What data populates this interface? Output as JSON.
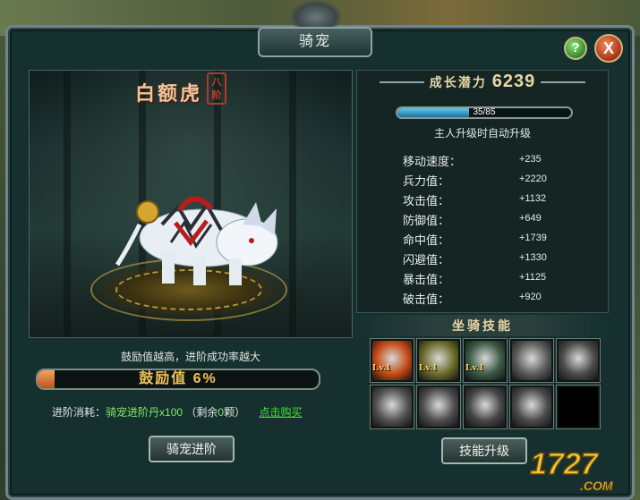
{
  "window": {
    "title": "骑宠"
  },
  "controls": {
    "help_label": "?",
    "close_label": "X"
  },
  "pet": {
    "name": "白额虎",
    "rank": [
      "八",
      "阶"
    ],
    "hint": "鼓励值越高，进阶成功率越大",
    "inspire_label": "鼓励值 6%",
    "inspire_fraction": 0.06
  },
  "advance": {
    "cost_label": "进阶消耗：",
    "cost_item": "骑宠进阶丹x100",
    "remaining_prefix": "（剩余",
    "remaining_count": "0",
    "remaining_suffix": "颗）",
    "buy_link": "点击购买",
    "button_label": "骑宠进阶"
  },
  "growth": {
    "label": "成长潜力",
    "value": "6239"
  },
  "exp": {
    "text": "35/85",
    "fraction": 0.41,
    "auto_level": "主人升级时自动升级"
  },
  "stats": [
    {
      "name": "移动速度：",
      "value": "+235"
    },
    {
      "name": "兵力值：",
      "value": "+2220"
    },
    {
      "name": "攻击值：",
      "value": "+1132"
    },
    {
      "name": "防御值：",
      "value": "+649"
    },
    {
      "name": "命中值：",
      "value": "+1739"
    },
    {
      "name": "闪避值：",
      "value": "+1330"
    },
    {
      "name": "暴击值：",
      "value": "+1125"
    },
    {
      "name": "破击值：",
      "value": "+920"
    }
  ],
  "skills": {
    "title": "坐骑技能",
    "button_label": "技能升级",
    "slots": [
      {
        "icon": "fire-skill-icon",
        "level": "Lv.1",
        "color": "#c44a14"
      },
      {
        "icon": "beast-skill-icon",
        "level": "Lv.1",
        "color": "#6b6a2a"
      },
      {
        "icon": "wolf-skill-icon",
        "level": "Lv.1",
        "color": "#3c5a44"
      },
      {
        "icon": "ghost-skill-icon",
        "level": "",
        "color": "#5a5a5a"
      },
      {
        "icon": "tiger-roar-skill-icon",
        "level": "",
        "color": "#4a4a4a"
      },
      {
        "icon": "charge-skill-icon",
        "level": "",
        "color": "#505050"
      },
      {
        "icon": "rider-skill-icon",
        "level": "",
        "color": "#4c4c4c"
      },
      {
        "icon": "howl-skill-icon",
        "level": "",
        "color": "#454545"
      },
      {
        "icon": "spirit-skill-icon",
        "level": "",
        "color": "#4a4a4a"
      },
      {
        "icon": "empty-slot",
        "level": "",
        "color": "#000000"
      }
    ]
  },
  "watermark": {
    "text": "1727.COM"
  }
}
